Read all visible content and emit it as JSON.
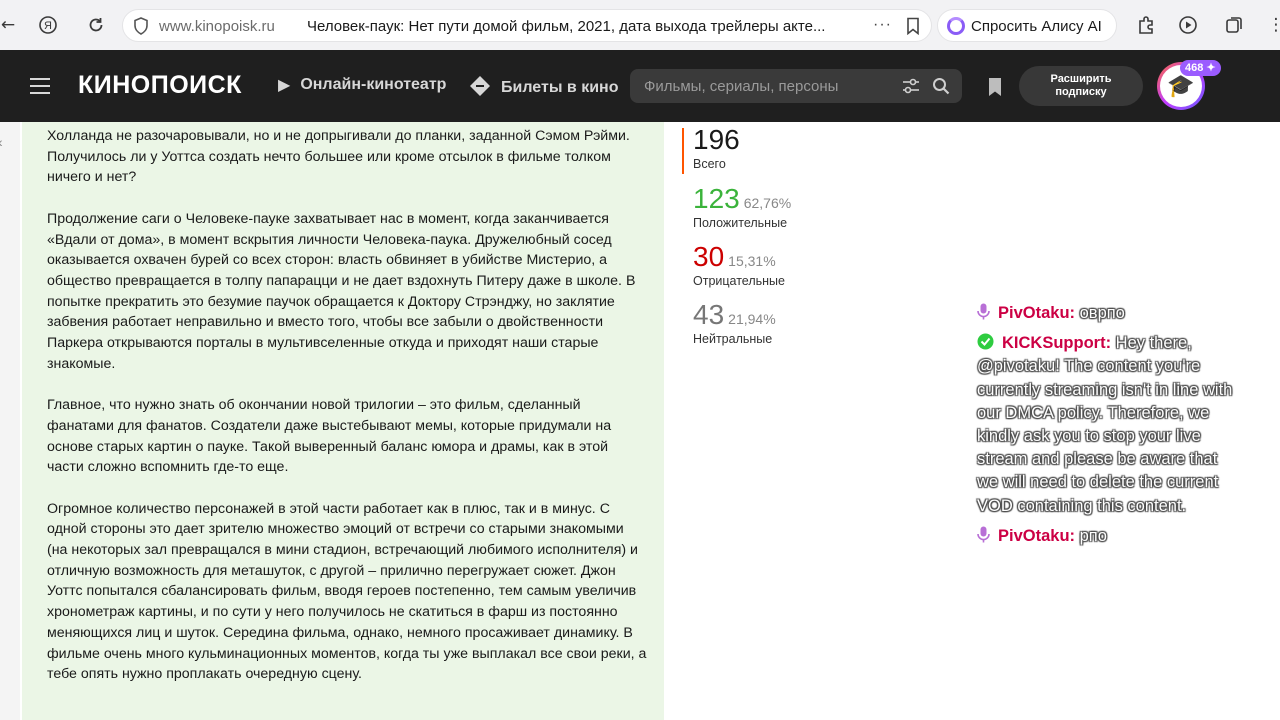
{
  "browser": {
    "domain": "www.kinopoisk.ru",
    "tab_title": "Человек-паук: Нет пути домой фильм, 2021, дата выхода трейлеры акте...",
    "more": "···",
    "alice_label": "Спросить Алису AI"
  },
  "header": {
    "logo": "КИНОПОИСК",
    "nav": [
      {
        "label": "Онлайн-кинотеатр",
        "icon": "play-icon"
      },
      {
        "label": "Билеты в кино",
        "icon": "ticket-icon"
      }
    ],
    "search_placeholder": "Фильмы, сериалы, персоны",
    "upgrade_label_1": "Расширить",
    "upgrade_label_2": "подписку",
    "badge_count": "468"
  },
  "review": {
    "paragraphs": [
      "Холланда не разочаровывали, но и не допрыгивали до планки, заданной Сэмом Рэйми. Получилось ли у Уоттса создать нечто большее или кроме отсылок в фильме толком ничего и нет?",
      "Продолжение саги о Человеке-пауке захватывает нас в момент, когда заканчивается «Вдали от дома», в момент вскрытия личности Человека-паука. Дружелюбный сосед оказывается охвачен бурей со всех сторон: власть обвиняет в убийстве Мистерио, а общество превращается в толпу папарацци и не дает вздохнуть Питеру даже в школе. В попытке прекратить это безумие паучок обращается к Доктору Стрэнджу, но заклятие забвения работает неправильно и вместо того, чтобы все забыли о двойственности Паркера открываются порталы в мультивселенные откуда и приходят наши старые знакомые.",
      "Главное, что нужно знать об окончании новой трилогии – это фильм, сделанный фанатами для фанатов. Создатели даже выстебывают мемы, которые придумали на основе старых картин о пауке. Такой выверенный баланс юмора и драмы, как в этой части сложно вспомнить где-то еще.",
      "Огромное количество персонажей в этой части работает как в плюс, так и в минус. С одной стороны это дает зрителю множество эмоций от встречи со старыми знакомыми (на некоторых зал превращался в мини стадион, встречающий любимого исполнителя) и отличную возможность для меташуток, с другой – прилично перегружает сюжет. Джон Уоттс попытался сбалансировать фильм, вводя героев постепенно, тем самым увеличив хронометраж картины, и по сути у него получилось не скатиться в фарш из постоянно меняющихся лиц и шуток. Середина фильма, однако, немного просаживает динамику. В фильме очень много кульминационных моментов, когда ты уже выплакал все свои реки, а тебе опять нужно проплакать очередную сцену."
    ]
  },
  "stats": {
    "total": {
      "value": "196",
      "label": "Всего",
      "color": "#1a1a1a"
    },
    "positive": {
      "value": "123",
      "pct": "62,76%",
      "label": "Положительные",
      "color": "#3bb33b"
    },
    "negative": {
      "value": "30",
      "pct": "15,31%",
      "label": "Отрицательные",
      "color": "#cc0000"
    },
    "neutral": {
      "value": "43",
      "pct": "21,94%",
      "label": "Нейтральные",
      "color": "#777777"
    }
  },
  "chat": [
    {
      "user": "PivOtaku",
      "sep": ":",
      "text": "оврпо",
      "badge": "mic-icon"
    },
    {
      "user": "KICKSupport",
      "sep": ":",
      "text": "Hey there, @pivotaku! The content you're currently streaming isn't in line with our DMCA policy. Therefore, we kindly ask you to stop your live stream and please be aware that we will need to delete the current VOD containing this content.",
      "badge": "verified-icon"
    },
    {
      "user": "PivOtaku",
      "sep": ":",
      "text": "рпо",
      "badge": "mic-icon"
    }
  ]
}
